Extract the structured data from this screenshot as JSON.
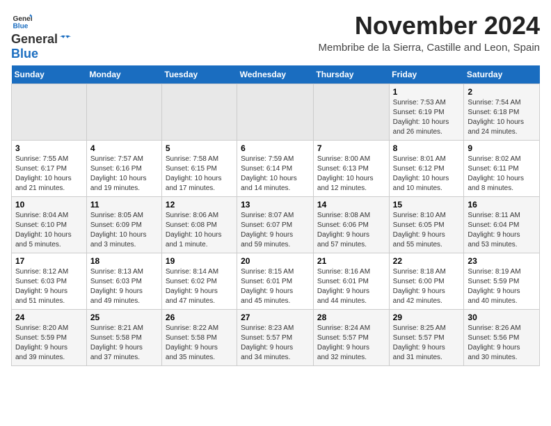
{
  "logo": {
    "line1": "General",
    "line2": "Blue"
  },
  "title": "November 2024",
  "subtitle": "Membribe de la Sierra, Castille and Leon, Spain",
  "days_of_week": [
    "Sunday",
    "Monday",
    "Tuesday",
    "Wednesday",
    "Thursday",
    "Friday",
    "Saturday"
  ],
  "weeks": [
    [
      {
        "day": "",
        "info": ""
      },
      {
        "day": "",
        "info": ""
      },
      {
        "day": "",
        "info": ""
      },
      {
        "day": "",
        "info": ""
      },
      {
        "day": "",
        "info": ""
      },
      {
        "day": "1",
        "info": "Sunrise: 7:53 AM\nSunset: 6:19 PM\nDaylight: 10 hours\nand 26 minutes."
      },
      {
        "day": "2",
        "info": "Sunrise: 7:54 AM\nSunset: 6:18 PM\nDaylight: 10 hours\nand 24 minutes."
      }
    ],
    [
      {
        "day": "3",
        "info": "Sunrise: 7:55 AM\nSunset: 6:17 PM\nDaylight: 10 hours\nand 21 minutes."
      },
      {
        "day": "4",
        "info": "Sunrise: 7:57 AM\nSunset: 6:16 PM\nDaylight: 10 hours\nand 19 minutes."
      },
      {
        "day": "5",
        "info": "Sunrise: 7:58 AM\nSunset: 6:15 PM\nDaylight: 10 hours\nand 17 minutes."
      },
      {
        "day": "6",
        "info": "Sunrise: 7:59 AM\nSunset: 6:14 PM\nDaylight: 10 hours\nand 14 minutes."
      },
      {
        "day": "7",
        "info": "Sunrise: 8:00 AM\nSunset: 6:13 PM\nDaylight: 10 hours\nand 12 minutes."
      },
      {
        "day": "8",
        "info": "Sunrise: 8:01 AM\nSunset: 6:12 PM\nDaylight: 10 hours\nand 10 minutes."
      },
      {
        "day": "9",
        "info": "Sunrise: 8:02 AM\nSunset: 6:11 PM\nDaylight: 10 hours\nand 8 minutes."
      }
    ],
    [
      {
        "day": "10",
        "info": "Sunrise: 8:04 AM\nSunset: 6:10 PM\nDaylight: 10 hours\nand 5 minutes."
      },
      {
        "day": "11",
        "info": "Sunrise: 8:05 AM\nSunset: 6:09 PM\nDaylight: 10 hours\nand 3 minutes."
      },
      {
        "day": "12",
        "info": "Sunrise: 8:06 AM\nSunset: 6:08 PM\nDaylight: 10 hours\nand 1 minute."
      },
      {
        "day": "13",
        "info": "Sunrise: 8:07 AM\nSunset: 6:07 PM\nDaylight: 9 hours\nand 59 minutes."
      },
      {
        "day": "14",
        "info": "Sunrise: 8:08 AM\nSunset: 6:06 PM\nDaylight: 9 hours\nand 57 minutes."
      },
      {
        "day": "15",
        "info": "Sunrise: 8:10 AM\nSunset: 6:05 PM\nDaylight: 9 hours\nand 55 minutes."
      },
      {
        "day": "16",
        "info": "Sunrise: 8:11 AM\nSunset: 6:04 PM\nDaylight: 9 hours\nand 53 minutes."
      }
    ],
    [
      {
        "day": "17",
        "info": "Sunrise: 8:12 AM\nSunset: 6:03 PM\nDaylight: 9 hours\nand 51 minutes."
      },
      {
        "day": "18",
        "info": "Sunrise: 8:13 AM\nSunset: 6:03 PM\nDaylight: 9 hours\nand 49 minutes."
      },
      {
        "day": "19",
        "info": "Sunrise: 8:14 AM\nSunset: 6:02 PM\nDaylight: 9 hours\nand 47 minutes."
      },
      {
        "day": "20",
        "info": "Sunrise: 8:15 AM\nSunset: 6:01 PM\nDaylight: 9 hours\nand 45 minutes."
      },
      {
        "day": "21",
        "info": "Sunrise: 8:16 AM\nSunset: 6:01 PM\nDaylight: 9 hours\nand 44 minutes."
      },
      {
        "day": "22",
        "info": "Sunrise: 8:18 AM\nSunset: 6:00 PM\nDaylight: 9 hours\nand 42 minutes."
      },
      {
        "day": "23",
        "info": "Sunrise: 8:19 AM\nSunset: 5:59 PM\nDaylight: 9 hours\nand 40 minutes."
      }
    ],
    [
      {
        "day": "24",
        "info": "Sunrise: 8:20 AM\nSunset: 5:59 PM\nDaylight: 9 hours\nand 39 minutes."
      },
      {
        "day": "25",
        "info": "Sunrise: 8:21 AM\nSunset: 5:58 PM\nDaylight: 9 hours\nand 37 minutes."
      },
      {
        "day": "26",
        "info": "Sunrise: 8:22 AM\nSunset: 5:58 PM\nDaylight: 9 hours\nand 35 minutes."
      },
      {
        "day": "27",
        "info": "Sunrise: 8:23 AM\nSunset: 5:57 PM\nDaylight: 9 hours\nand 34 minutes."
      },
      {
        "day": "28",
        "info": "Sunrise: 8:24 AM\nSunset: 5:57 PM\nDaylight: 9 hours\nand 32 minutes."
      },
      {
        "day": "29",
        "info": "Sunrise: 8:25 AM\nSunset: 5:57 PM\nDaylight: 9 hours\nand 31 minutes."
      },
      {
        "day": "30",
        "info": "Sunrise: 8:26 AM\nSunset: 5:56 PM\nDaylight: 9 hours\nand 30 minutes."
      }
    ]
  ]
}
